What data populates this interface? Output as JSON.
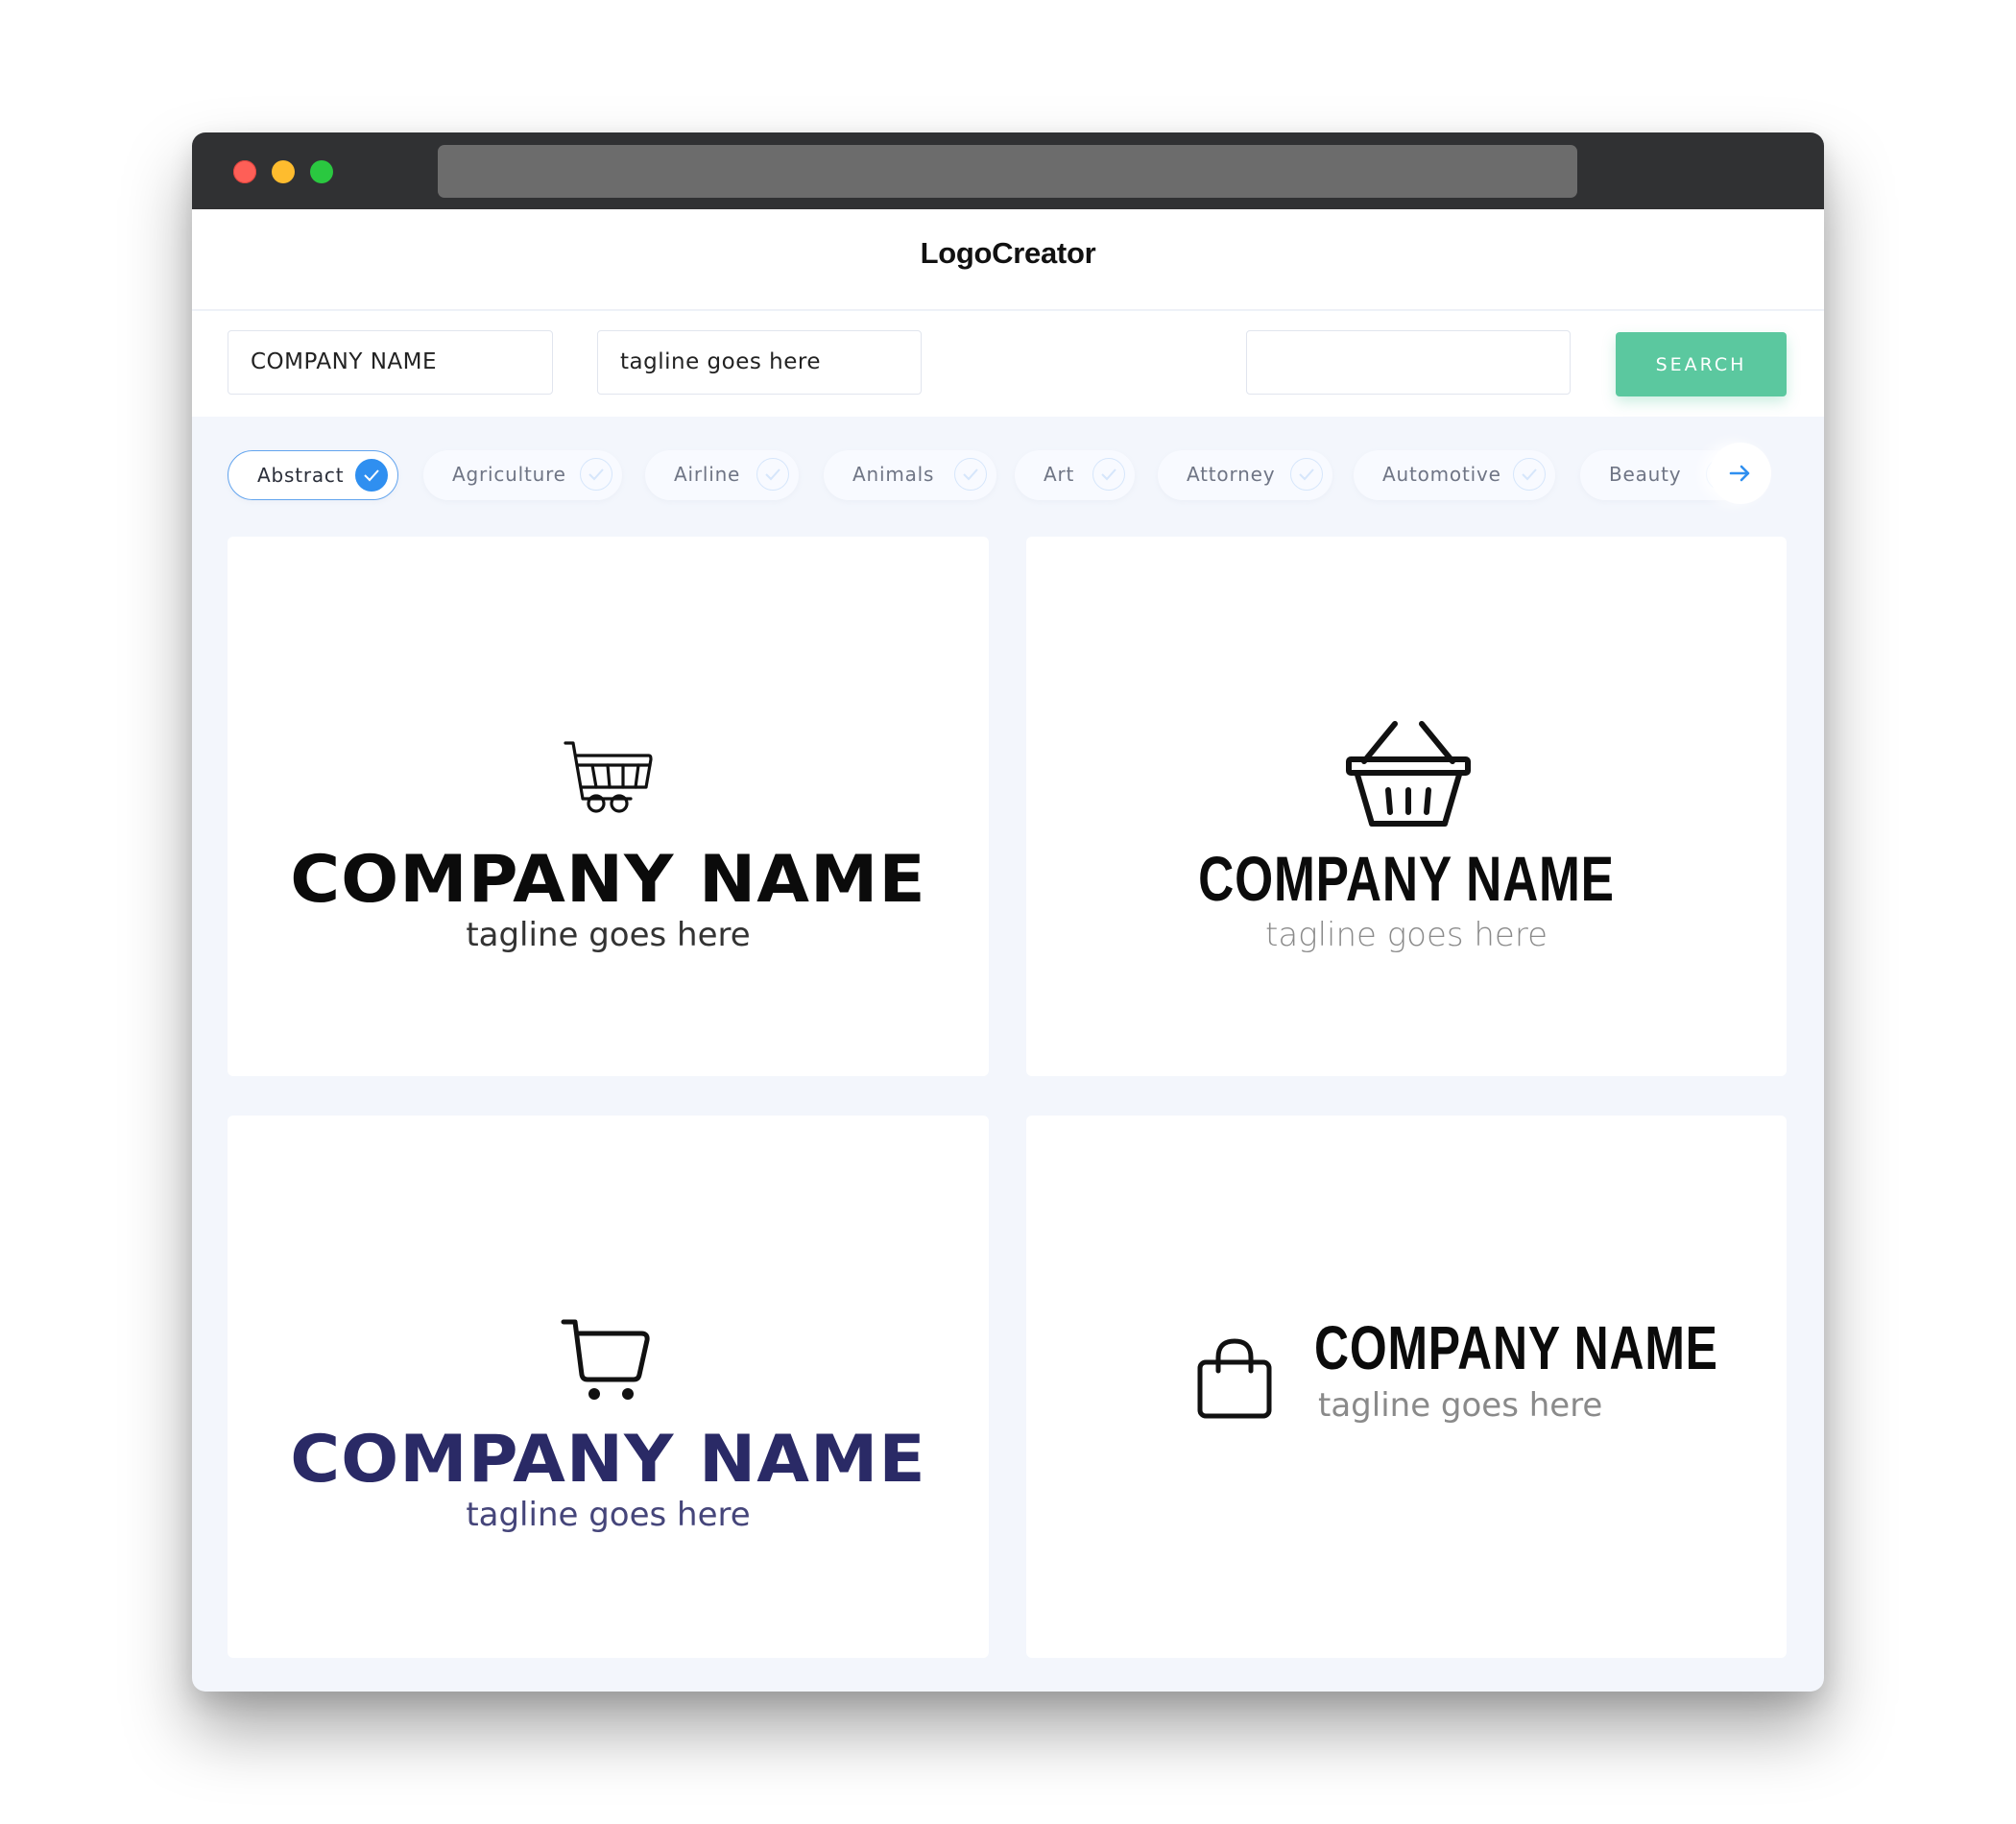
{
  "window": {
    "traffic_lights": [
      "close",
      "minimize",
      "maximize"
    ],
    "url": ""
  },
  "header": {
    "title": "LogoCreator"
  },
  "toolbar": {
    "company_name_value": "COMPANY NAME",
    "tagline_value": "tagline goes here",
    "search_field_value": "",
    "search_label": "SEARCH"
  },
  "categories": [
    {
      "label": "Abstract",
      "selected": true
    },
    {
      "label": "Agriculture",
      "selected": false
    },
    {
      "label": "Airline",
      "selected": false
    },
    {
      "label": "Animals",
      "selected": false
    },
    {
      "label": "Art",
      "selected": false
    },
    {
      "label": "Attorney",
      "selected": false
    },
    {
      "label": "Automotive",
      "selected": false
    },
    {
      "label": "Beauty",
      "selected": false
    }
  ],
  "next_icon": "arrow-right-icon",
  "colors": {
    "accent_blue": "#2f8ff0",
    "search_green": "#5bc89f",
    "navy": "#2a2a66"
  },
  "logos": [
    {
      "icon": "shopping-cart-icon",
      "company": "COMPANY NAME",
      "tagline": "tagline goes here"
    },
    {
      "icon": "shopping-basket-icon",
      "company": "COMPANY NAME",
      "tagline": "tagline goes here"
    },
    {
      "icon": "simple-cart-icon",
      "company": "COMPANY NAME",
      "tagline": "tagline goes here"
    },
    {
      "icon": "shopping-bag-icon",
      "company": "COMPANY NAME",
      "tagline": "tagline goes here"
    }
  ]
}
